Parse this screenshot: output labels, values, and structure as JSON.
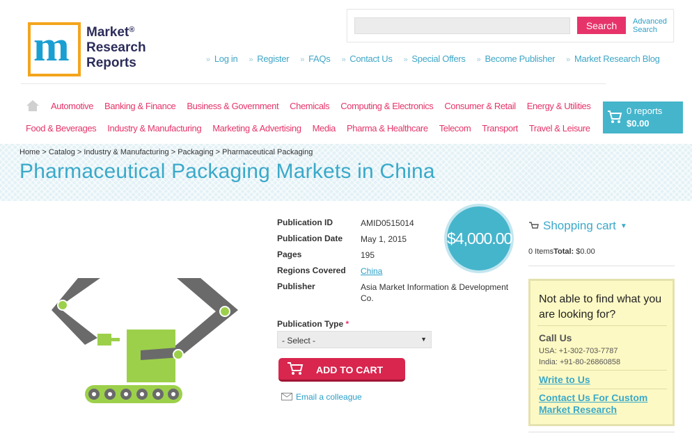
{
  "logo": {
    "line1": "Market",
    "line2": "Research",
    "line3": "Reports",
    "reg": "®",
    "mark": "m"
  },
  "search": {
    "placeholder": "",
    "button": "Search",
    "advanced": "Advanced Search"
  },
  "top_links": [
    "Log in",
    "Register",
    "FAQs",
    "Contact Us",
    "Special Offers",
    "Become Publisher",
    "Market Research Blog"
  ],
  "categories_row1": [
    "Automotive",
    "Banking & Finance",
    "Business & Government",
    "Chemicals",
    "Computing & Electronics",
    "Consumer & Retail",
    "Energy & Utilities"
  ],
  "categories_row2": [
    "Food & Beverages",
    "Industry & Manufacturing",
    "Marketing & Advertising",
    "Media",
    "Pharma & Healthcare",
    "Telecom",
    "Transport",
    "Travel & Leisure"
  ],
  "cart": {
    "reports": "0 reports",
    "amount": "$0.00"
  },
  "breadcrumb": [
    "Home",
    "Catalog",
    "Industry & Manufacturing",
    "Packaging",
    "Pharmaceutical Packaging"
  ],
  "breadcrumb_sep": " > ",
  "title": "Pharmaceutical Packaging Markets in China",
  "product": {
    "price": "$4,000.00",
    "fields": [
      {
        "label": "Publication ID",
        "value": "AMID0515014"
      },
      {
        "label": "Publication Date",
        "value": "May 1, 2015"
      },
      {
        "label": "Pages",
        "value": "195"
      },
      {
        "label": "Regions Covered",
        "value": "China"
      },
      {
        "label": "Publisher",
        "value": "Asia Market Information & Development Co."
      }
    ],
    "pub_type_label": "Publication Type",
    "required_mark": "*",
    "select_value": "- Select -",
    "add_to_cart": "ADD TO CART",
    "email_colleague": "Email a colleague"
  },
  "sidebar": {
    "cart_title": "Shopping cart",
    "items_text": "0 Items",
    "total_label": "Total:",
    "total_value": "$0.00",
    "help_question": "Not able to find what you are looking for?",
    "call_us": "Call Us",
    "usa_phone": "USA: +1-302-703-7787",
    "india_phone": "India: +91-80-26860858",
    "write_to_us": "Write to Us",
    "custom_research": "Contact Us For Custom Market Research"
  },
  "colors": {
    "accent_pink": "#e6346a",
    "accent_blue": "#45b5cc",
    "link_blue": "#2a9fc7"
  }
}
